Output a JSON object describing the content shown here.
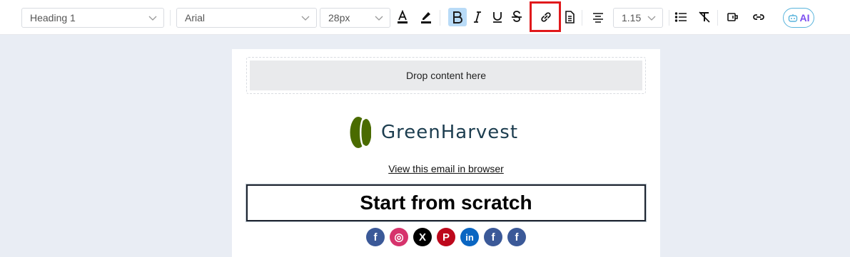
{
  "toolbar": {
    "block_style": "Heading 1",
    "font_family": "Arial",
    "font_size": "28px",
    "line_height": "1.15",
    "ai_label": "AI",
    "active_button": "bold",
    "highlighted_button": "insert-link"
  },
  "canvas": {
    "dropzone_text": "Drop content here",
    "logo_text": "GreenHarvest",
    "view_in_browser": "View this email in browser",
    "heading": "Start from scratch"
  },
  "social": [
    {
      "name": "facebook",
      "glyph": "f",
      "color": "#3b5998"
    },
    {
      "name": "instagram",
      "glyph": "◎",
      "color": "#d6336c"
    },
    {
      "name": "x",
      "glyph": "X",
      "color": "#000000"
    },
    {
      "name": "pinterest",
      "glyph": "P",
      "color": "#bd081c"
    },
    {
      "name": "linkedin",
      "glyph": "in",
      "color": "#0a66c2"
    },
    {
      "name": "facebook",
      "glyph": "f",
      "color": "#3b5998"
    },
    {
      "name": "facebook",
      "glyph": "f",
      "color": "#3b5998"
    }
  ],
  "colors": {
    "logo_leaf": "#4a6b00",
    "logo_text": "#1c3d4f",
    "highlight": "#e0191c",
    "active_button_bg": "#b9dbf7"
  }
}
